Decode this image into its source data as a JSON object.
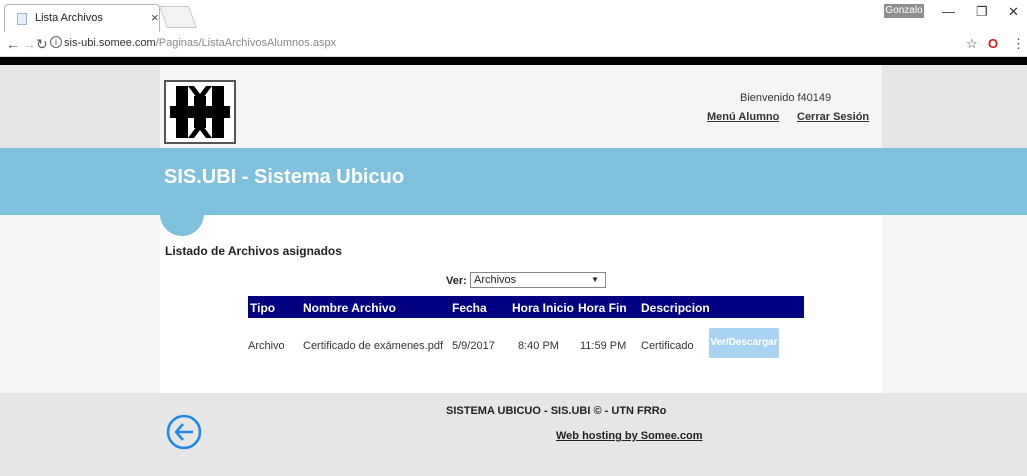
{
  "browser": {
    "tab_title": "Lista Archivos",
    "tab_close": "×",
    "profile_name": "Gonzalo",
    "url_domain": "sis-ubi.somee.com",
    "url_path": "/Paginas/ListaArchivosAlumnos.aspx"
  },
  "header": {
    "welcome": "Bienvenido f40149",
    "menu_link": "Menú Alumno",
    "logout_link": "Cerrar Sesión"
  },
  "banner": {
    "title": "SIS.UBI - Sistema Ubicuo"
  },
  "main": {
    "list_title": "Listado de Archivos asignados",
    "filter_label": "Ver:",
    "filter_value": "Archivos",
    "columns": [
      "Tipo",
      "Nombre Archivo",
      "Fecha",
      "Hora Inicio",
      "Hora Fin",
      "Descripcion"
    ],
    "rows": [
      {
        "tipo": "Archivo",
        "nombre": "Certificado de exámenes.pdf",
        "fecha": "5/9/2017",
        "hora_inicio": "8:40 PM",
        "hora_fin": "11:59 PM",
        "descripcion": "Certificado",
        "action": "Ver/Descargar"
      }
    ]
  },
  "footer": {
    "text": "SISTEMA UBICUO - SIS.UBI © - UTN FRRo",
    "hosting_link": "Web hosting by Somee.com"
  },
  "colors": {
    "banner": "#7fc0dc",
    "table_header": "#000080",
    "button": "#a9d3f2"
  }
}
